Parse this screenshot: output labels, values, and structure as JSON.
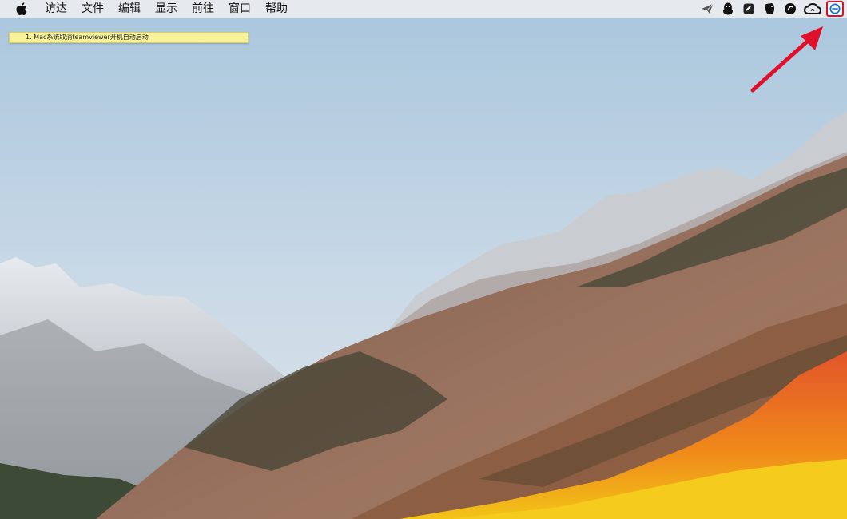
{
  "menubar": {
    "apple_icon": "apple-logo-icon",
    "items": [
      "访达",
      "文件",
      "编辑",
      "显示",
      "前往",
      "窗口",
      "帮助"
    ]
  },
  "status_icons": [
    "paper-plane-icon",
    "qq-penguin-icon",
    "evernote-square-icon",
    "evernote-elephant-icon",
    "cleaner-icon",
    "creative-cloud-icon",
    "teamviewer-icon"
  ],
  "note": {
    "text": "1. Mac系统取消teamviewer开机自动启动",
    "color": "#f7f29a"
  },
  "highlight": {
    "color": "#e0102a"
  }
}
